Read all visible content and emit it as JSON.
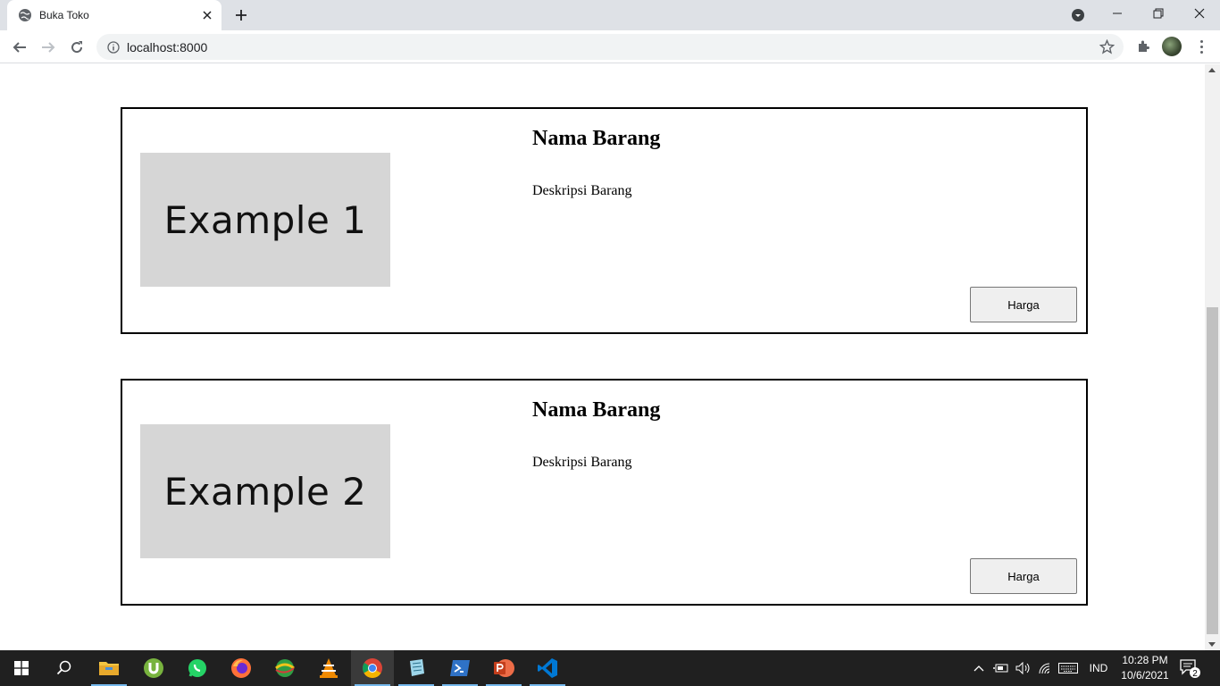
{
  "browser": {
    "tab_title": "Buka Toko",
    "url": "localhost:8000"
  },
  "products": [
    {
      "image_text": "Example 1",
      "name": "Nama Barang",
      "description": "Deskripsi Barang",
      "button_label": "Harga"
    },
    {
      "image_text": "Example 2",
      "name": "Nama Barang",
      "description": "Deskripsi Barang",
      "button_label": "Harga"
    }
  ],
  "taskbar": {
    "apps": [
      "start",
      "search",
      "file-explorer",
      "utorrent",
      "whatsapp",
      "firefox",
      "internet-download-manager",
      "vlc",
      "chrome",
      "notepad",
      "powershell",
      "powerpoint",
      "vscode"
    ],
    "language": "IND",
    "time": "10:28 PM",
    "date": "10/6/2021",
    "notification_count": "2"
  },
  "scroll": {
    "position_fraction": 1.0
  }
}
